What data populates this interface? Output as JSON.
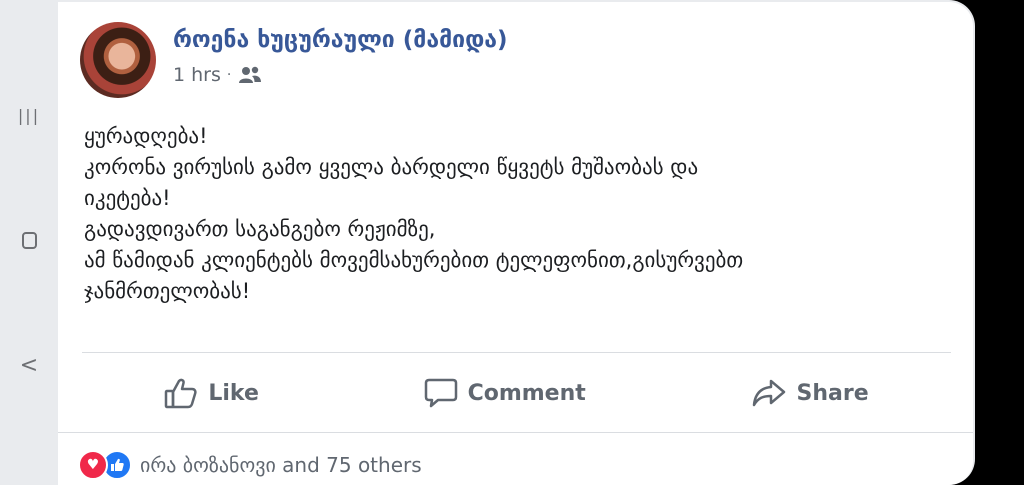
{
  "system_nav": {
    "recent_glyph": "|||",
    "back_glyph": "<"
  },
  "post": {
    "author": "როენა ხუცურაული (მამიდა)",
    "time": "1 hrs",
    "separator": "·",
    "audience_icon": "friends-icon",
    "lines": [
      "ყურადღება!",
      "კორონა ვირუსის გამო ყველა ბარდელი წყვეტს მუშაობას და",
      "იკეტება!",
      "გადავდივართ საგანგებო რეჟიმზე,",
      "ამ წამიდან კლიენტებს მოვემსახურებით ტელეფონით,გისურვებთ",
      "ჯანმრთელობას!"
    ]
  },
  "actions": {
    "like": "Like",
    "comment": "Comment",
    "share": "Share"
  },
  "reactions": {
    "summary": "ირა ბოზანოვი and 75 others",
    "love_color": "#f0284a",
    "like_color": "#2078f4"
  },
  "colors": {
    "link": "#385898",
    "secondary_text": "#606770",
    "background": "#e9ebee"
  }
}
